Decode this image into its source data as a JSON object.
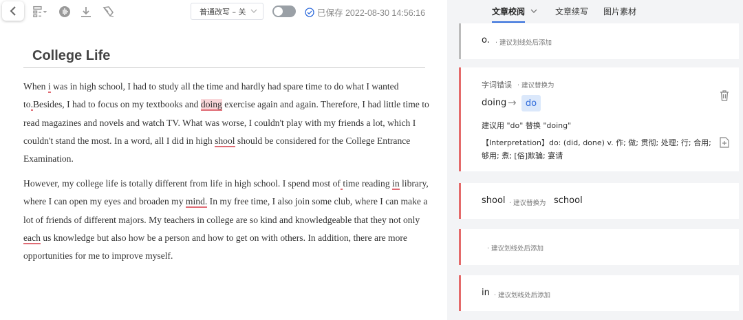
{
  "toolbar": {
    "mode_label": "普通改写 – 关",
    "saved_text": "已保存 2022-08-30 14:56:16"
  },
  "tabs": [
    {
      "label": "文章校阅"
    },
    {
      "label": "文章续写"
    },
    {
      "label": "图片素材"
    }
  ],
  "document": {
    "title": "College Life",
    "p1": {
      "s1": "When ",
      "e1": "i",
      "s2": " was in high school, I had to study all the time and hardly had spare time to do what I wanted to",
      "e2": ".",
      "s3": "Besides, I had to focus on my textbooks and ",
      "e3": "doing",
      "s4": " exercise again and again. Therefore, I had little time to read magazines and novels and watch TV. What was worse, I couldn't play with my friends a lot, which I couldn't stand the most. In a word, all I did in high ",
      "e4": "shool",
      "s5": " should be considered for the College Entrance Examination."
    },
    "p2": {
      "s1": "However, my college life is totally different from life in high school. I spend most of",
      "e1": " ",
      "s2": "time reading ",
      "e2": "in",
      "s3": " library, where I can open my eyes and broaden my ",
      "e3": "mind.",
      "s4": " In my free time, I also join some club, where I can make a lot of friends of different majors. My teachers in college are so kind and knowledgeable that they not only ",
      "e4": "each",
      "s5": " us knowledge but also how be a person and how to get on with others. In addition, there are more opportunities for me to improve myself."
    }
  },
  "cards": {
    "c1": {
      "word": "o.",
      "hint": "· 建议划线处后添加"
    },
    "c2": {
      "category": "字词错误",
      "hint": "· 建议替换为",
      "original": "doing",
      "arrow": "→",
      "suggestion": "do",
      "advice": "建议用 \"do\" 替换 \"doing\"",
      "interpretation": "【Interpretation】do: (did, done) v. 作; 做; 贯彻; 处理; 行; 合用; 够用; 煮; [俗]欺骗; 宴请"
    },
    "c3": {
      "word": "shool",
      "hint": "· 建议替换为",
      "suggestion": "school"
    },
    "c4": {
      "hint": "· 建议划线处后添加"
    },
    "c5": {
      "word": "in",
      "hint": "· 建议划线处后添加"
    }
  },
  "colors": {
    "accent": "#2f6bdb",
    "error": "#e06c75",
    "error_bar": "#e46a6a"
  }
}
